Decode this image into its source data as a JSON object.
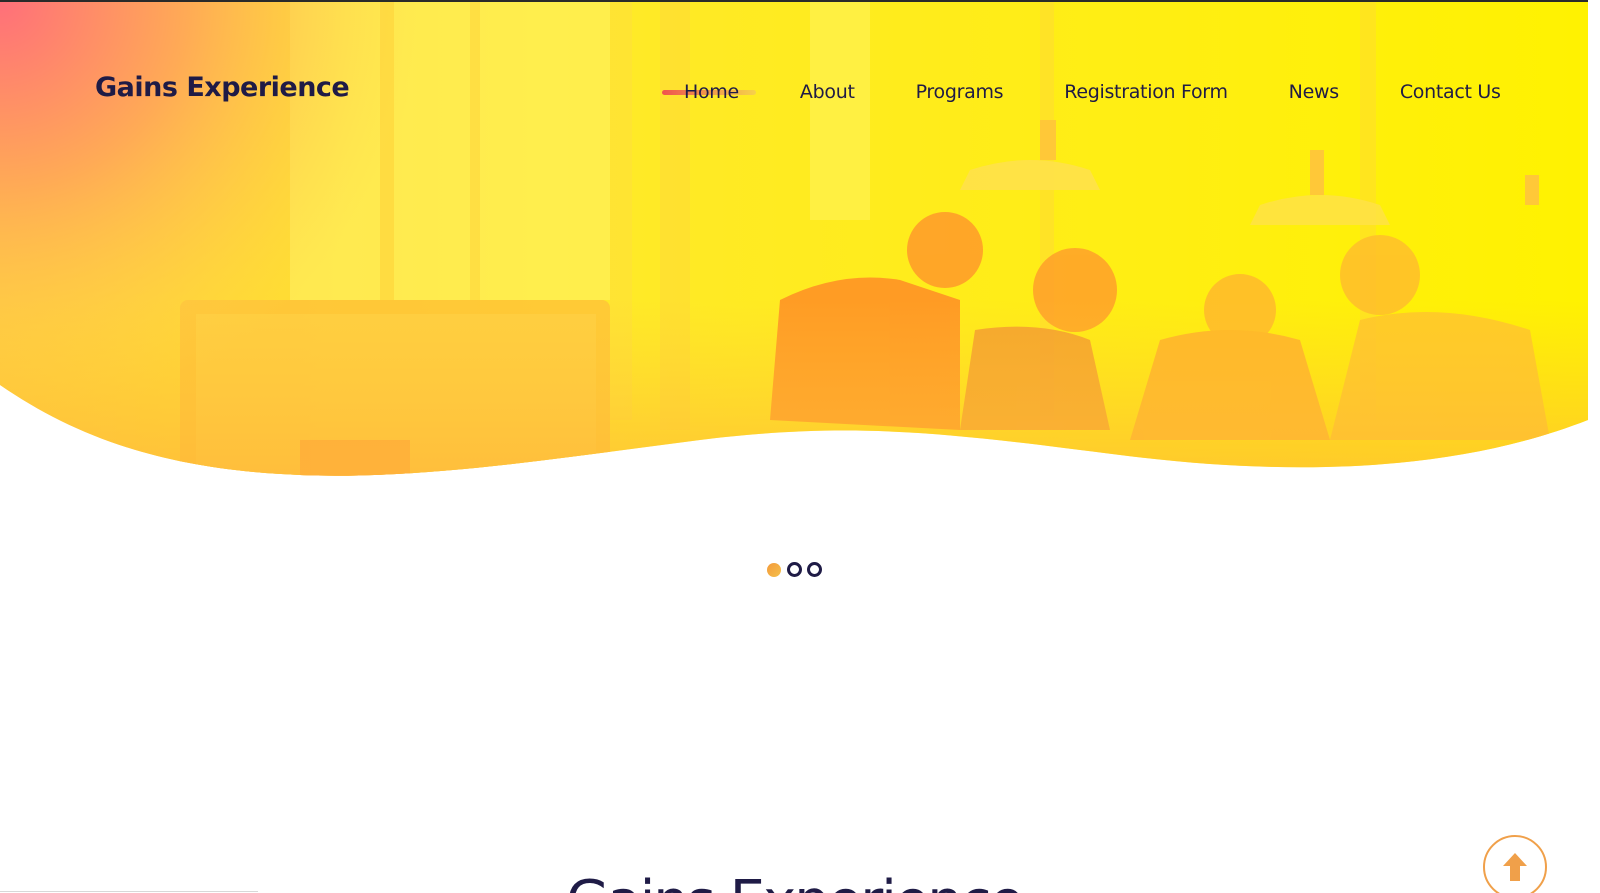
{
  "header": {
    "logo_text": "Gains Experience",
    "nav": [
      {
        "label": "Home",
        "active": true
      },
      {
        "label": "About",
        "active": false
      },
      {
        "label": "Programs",
        "active": false
      },
      {
        "label": "Registration Form",
        "active": false
      },
      {
        "label": "News",
        "active": false
      },
      {
        "label": "Contact Us",
        "active": false
      }
    ]
  },
  "hero": {
    "image_description_icon": "team-meeting-photo",
    "overlay_colors": [
      "#ff6b6b",
      "#ffb347",
      "#fff200"
    ]
  },
  "slider": {
    "total": 3,
    "active_index": 0
  },
  "section": {
    "title": "Gains Experience"
  },
  "back_to_top": {
    "icon": "arrow-up-icon",
    "color": "#f0a04a"
  },
  "colors": {
    "text_dark": "#1f1b46",
    "accent_orange": "#f29a4b",
    "accent_red": "#f0524e",
    "accent_yellow": "#fff200"
  }
}
